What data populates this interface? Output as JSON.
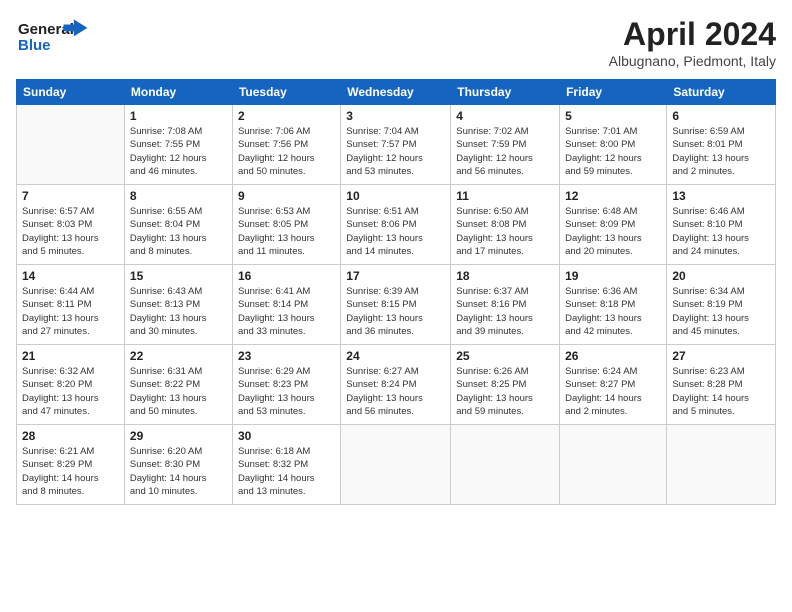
{
  "logo": {
    "line1": "General",
    "line2": "Blue"
  },
  "title": "April 2024",
  "location": "Albugnano, Piedmont, Italy",
  "header_days": [
    "Sunday",
    "Monday",
    "Tuesday",
    "Wednesday",
    "Thursday",
    "Friday",
    "Saturday"
  ],
  "weeks": [
    [
      {
        "day": "",
        "info": ""
      },
      {
        "day": "1",
        "info": "Sunrise: 7:08 AM\nSunset: 7:55 PM\nDaylight: 12 hours\nand 46 minutes."
      },
      {
        "day": "2",
        "info": "Sunrise: 7:06 AM\nSunset: 7:56 PM\nDaylight: 12 hours\nand 50 minutes."
      },
      {
        "day": "3",
        "info": "Sunrise: 7:04 AM\nSunset: 7:57 PM\nDaylight: 12 hours\nand 53 minutes."
      },
      {
        "day": "4",
        "info": "Sunrise: 7:02 AM\nSunset: 7:59 PM\nDaylight: 12 hours\nand 56 minutes."
      },
      {
        "day": "5",
        "info": "Sunrise: 7:01 AM\nSunset: 8:00 PM\nDaylight: 12 hours\nand 59 minutes."
      },
      {
        "day": "6",
        "info": "Sunrise: 6:59 AM\nSunset: 8:01 PM\nDaylight: 13 hours\nand 2 minutes."
      }
    ],
    [
      {
        "day": "7",
        "info": "Sunrise: 6:57 AM\nSunset: 8:03 PM\nDaylight: 13 hours\nand 5 minutes."
      },
      {
        "day": "8",
        "info": "Sunrise: 6:55 AM\nSunset: 8:04 PM\nDaylight: 13 hours\nand 8 minutes."
      },
      {
        "day": "9",
        "info": "Sunrise: 6:53 AM\nSunset: 8:05 PM\nDaylight: 13 hours\nand 11 minutes."
      },
      {
        "day": "10",
        "info": "Sunrise: 6:51 AM\nSunset: 8:06 PM\nDaylight: 13 hours\nand 14 minutes."
      },
      {
        "day": "11",
        "info": "Sunrise: 6:50 AM\nSunset: 8:08 PM\nDaylight: 13 hours\nand 17 minutes."
      },
      {
        "day": "12",
        "info": "Sunrise: 6:48 AM\nSunset: 8:09 PM\nDaylight: 13 hours\nand 20 minutes."
      },
      {
        "day": "13",
        "info": "Sunrise: 6:46 AM\nSunset: 8:10 PM\nDaylight: 13 hours\nand 24 minutes."
      }
    ],
    [
      {
        "day": "14",
        "info": "Sunrise: 6:44 AM\nSunset: 8:11 PM\nDaylight: 13 hours\nand 27 minutes."
      },
      {
        "day": "15",
        "info": "Sunrise: 6:43 AM\nSunset: 8:13 PM\nDaylight: 13 hours\nand 30 minutes."
      },
      {
        "day": "16",
        "info": "Sunrise: 6:41 AM\nSunset: 8:14 PM\nDaylight: 13 hours\nand 33 minutes."
      },
      {
        "day": "17",
        "info": "Sunrise: 6:39 AM\nSunset: 8:15 PM\nDaylight: 13 hours\nand 36 minutes."
      },
      {
        "day": "18",
        "info": "Sunrise: 6:37 AM\nSunset: 8:16 PM\nDaylight: 13 hours\nand 39 minutes."
      },
      {
        "day": "19",
        "info": "Sunrise: 6:36 AM\nSunset: 8:18 PM\nDaylight: 13 hours\nand 42 minutes."
      },
      {
        "day": "20",
        "info": "Sunrise: 6:34 AM\nSunset: 8:19 PM\nDaylight: 13 hours\nand 45 minutes."
      }
    ],
    [
      {
        "day": "21",
        "info": "Sunrise: 6:32 AM\nSunset: 8:20 PM\nDaylight: 13 hours\nand 47 minutes."
      },
      {
        "day": "22",
        "info": "Sunrise: 6:31 AM\nSunset: 8:22 PM\nDaylight: 13 hours\nand 50 minutes."
      },
      {
        "day": "23",
        "info": "Sunrise: 6:29 AM\nSunset: 8:23 PM\nDaylight: 13 hours\nand 53 minutes."
      },
      {
        "day": "24",
        "info": "Sunrise: 6:27 AM\nSunset: 8:24 PM\nDaylight: 13 hours\nand 56 minutes."
      },
      {
        "day": "25",
        "info": "Sunrise: 6:26 AM\nSunset: 8:25 PM\nDaylight: 13 hours\nand 59 minutes."
      },
      {
        "day": "26",
        "info": "Sunrise: 6:24 AM\nSunset: 8:27 PM\nDaylight: 14 hours\nand 2 minutes."
      },
      {
        "day": "27",
        "info": "Sunrise: 6:23 AM\nSunset: 8:28 PM\nDaylight: 14 hours\nand 5 minutes."
      }
    ],
    [
      {
        "day": "28",
        "info": "Sunrise: 6:21 AM\nSunset: 8:29 PM\nDaylight: 14 hours\nand 8 minutes."
      },
      {
        "day": "29",
        "info": "Sunrise: 6:20 AM\nSunset: 8:30 PM\nDaylight: 14 hours\nand 10 minutes."
      },
      {
        "day": "30",
        "info": "Sunrise: 6:18 AM\nSunset: 8:32 PM\nDaylight: 14 hours\nand 13 minutes."
      },
      {
        "day": "",
        "info": ""
      },
      {
        "day": "",
        "info": ""
      },
      {
        "day": "",
        "info": ""
      },
      {
        "day": "",
        "info": ""
      }
    ]
  ]
}
